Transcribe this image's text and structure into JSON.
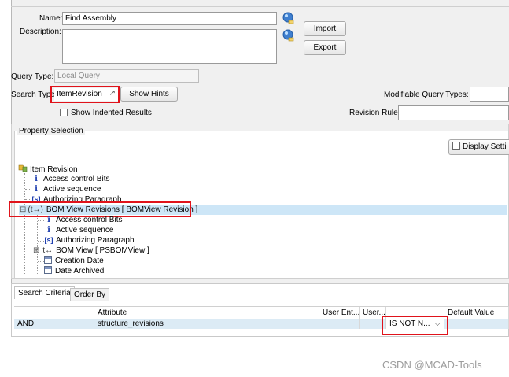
{
  "form": {
    "name_label": "Name:",
    "name_value": "Find Assembly",
    "description_label": "Description:",
    "description_value": "",
    "import_label": "Import",
    "export_label": "Export",
    "query_type_label": "Query Type:",
    "query_type_value": "Local Query",
    "search_type_label": "Search Type:",
    "search_type_value": "ItemRevision",
    "show_hints_label": "Show Hints",
    "modifiable_query_types_label": "Modifiable Query Types:",
    "show_indented_label": "Show Indented Results",
    "show_indented_checked": false,
    "revision_rule_label": "Revision Rule:"
  },
  "property_selection": {
    "title": "Property Selection",
    "display_settings_label": "Display Setti",
    "tree": [
      {
        "label": "Item Revision",
        "icon": "item-revision-icon"
      },
      {
        "label": "Access control Bits",
        "icon": "info-icon"
      },
      {
        "label": "Active sequence",
        "icon": "info-icon"
      },
      {
        "label": "Authorizing Paragraph",
        "icon": "bracket-s-icon"
      },
      {
        "label": "BOM View Revisions [ BOMView Revision ]",
        "icon": "reference-icon",
        "expander": "⊟",
        "prefix": "(t↔)"
      },
      {
        "label": "Access control Bits",
        "icon": "info-icon"
      },
      {
        "label": "Active sequence",
        "icon": "info-icon"
      },
      {
        "label": "Authorizing Paragraph",
        "icon": "bracket-s-icon"
      },
      {
        "label": "BOM View [ PSBOMView ]",
        "icon": "reference-icon",
        "expander": "⊞",
        "prefix": "t↔"
      },
      {
        "label": "Creation Date",
        "icon": "calendar-icon"
      },
      {
        "label": "Date Archived",
        "icon": "calendar-icon"
      }
    ]
  },
  "criteria": {
    "tabs": [
      "Search Criteria",
      "Order By"
    ],
    "columns": [
      "",
      "Attribute",
      "User Ent...",
      "User...",
      "",
      "Default Value"
    ],
    "rows": [
      {
        "logic": "AND",
        "attribute": "structure_revisions",
        "user_entry": "",
        "user": "",
        "operator": "IS NOT N...",
        "default_value": ""
      }
    ]
  },
  "watermark": "CSDN @MCAD-Tools",
  "colors": {
    "highlight_red": "#e0131b",
    "selected_row": "#dcebf5"
  }
}
